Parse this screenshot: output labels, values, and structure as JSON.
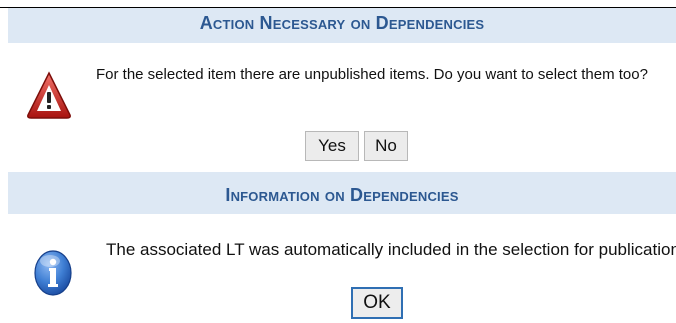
{
  "dialog_confirm": {
    "header": "Action Necessary on Dependencies",
    "icon": "warning-triangle-icon",
    "message": "For the selected item there are unpublished items. Do you want to select them too?",
    "yes_label": "Yes",
    "no_label": "No"
  },
  "dialog_info": {
    "header": "Information on Dependencies",
    "icon": "info-circle-icon",
    "message": "The associated LT was automatically included in the selection for publication",
    "ok_label": "OK"
  },
  "colors": {
    "header_background": "#dde8f4",
    "header_text": "#2c5891",
    "warning_red": "#c8241d",
    "info_blue": "#2b66c4"
  }
}
